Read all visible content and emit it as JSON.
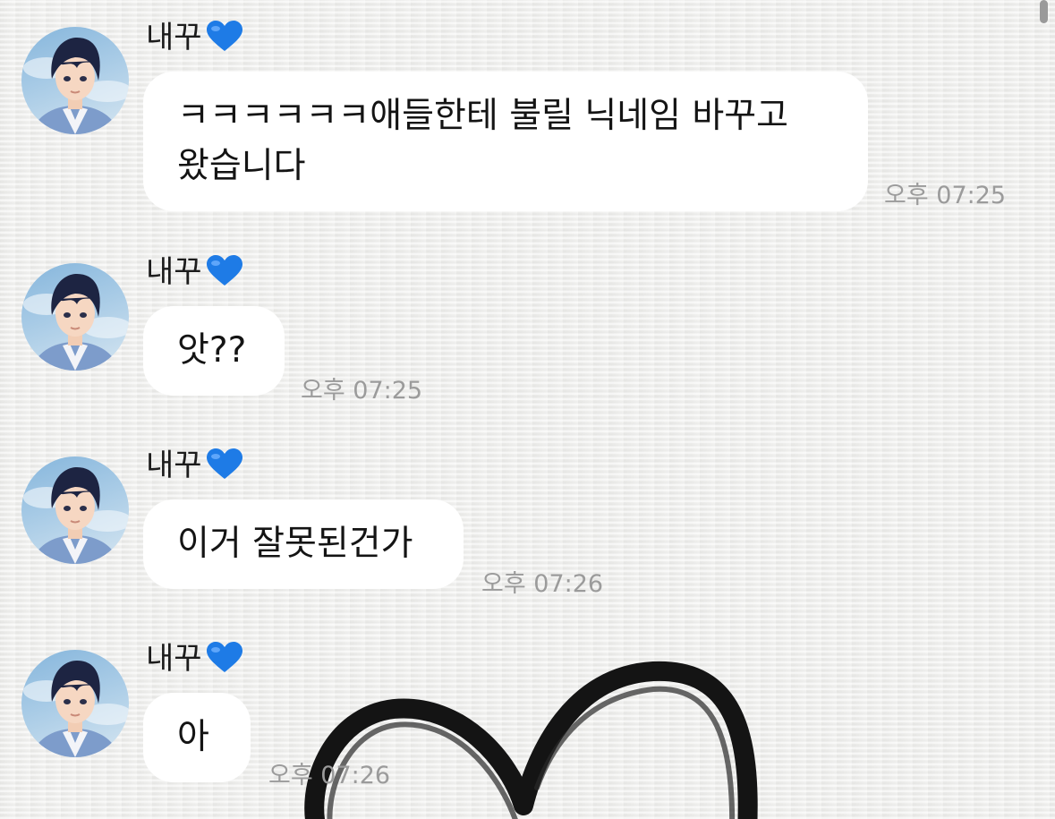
{
  "messages": [
    {
      "sender": "내꾸",
      "sender_emoji": "blue-heart-icon",
      "lines": [
        "ㅋㅋㅋㅋㅋㅋ애들한테 불릴 닉네임 바꾸고",
        "왔습니다"
      ],
      "time": "오후 07:25"
    },
    {
      "sender": "내꾸",
      "sender_emoji": "blue-heart-icon",
      "lines": [
        "앗??"
      ],
      "time": "오후 07:25"
    },
    {
      "sender": "내꾸",
      "sender_emoji": "blue-heart-icon",
      "lines": [
        "이거 잘못된건가"
      ],
      "time": "오후 07:26"
    },
    {
      "sender": "내꾸",
      "sender_emoji": "blue-heart-icon",
      "lines": [
        "아"
      ],
      "time": "오후 07:26"
    }
  ],
  "colors": {
    "background": "#eeeeec",
    "bubble": "#ffffff",
    "timestamp": "#9b9b9b",
    "heart_emoji": "#1e7be6",
    "doodle": "#141414"
  }
}
